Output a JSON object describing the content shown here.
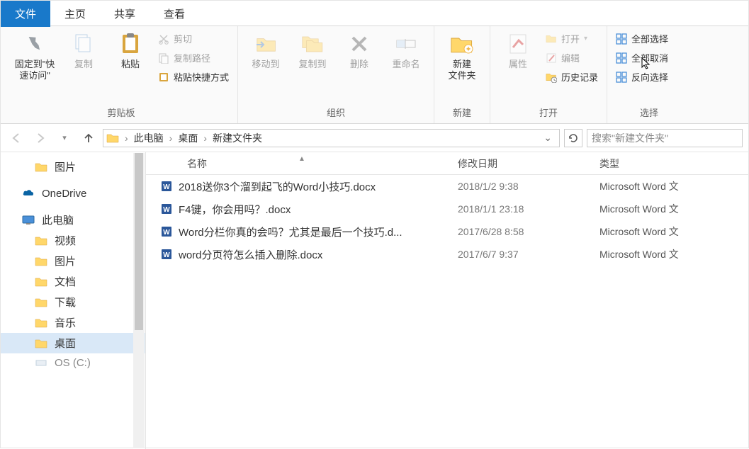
{
  "tabs": {
    "file": "文件",
    "home": "主页",
    "share": "共享",
    "view": "查看"
  },
  "ribbon": {
    "clipboard": {
      "pin": "固定到\"快\n速访问\"",
      "copy": "复制",
      "paste": "粘贴",
      "cut": "剪切",
      "copy_path": "复制路径",
      "paste_shortcut": "粘贴快捷方式",
      "label": "剪贴板"
    },
    "organize": {
      "move_to": "移动到",
      "copy_to": "复制到",
      "delete": "删除",
      "rename": "重命名",
      "label": "组织"
    },
    "new": {
      "new_folder": "新建\n文件夹",
      "label": "新建"
    },
    "open": {
      "properties": "属性",
      "open": "打开",
      "edit": "编辑",
      "history": "历史记录",
      "label": "打开"
    },
    "select": {
      "select_all": "全部选择",
      "select_none": "全部取消",
      "invert": "反向选择",
      "label": "选择"
    }
  },
  "breadcrumb": {
    "pc": "此电脑",
    "desktop": "桌面",
    "folder": "新建文件夹"
  },
  "search": {
    "placeholder": "搜索\"新建文件夹\""
  },
  "sidebar": {
    "pictures": "图片",
    "onedrive": "OneDrive",
    "this_pc": "此电脑",
    "videos": "视频",
    "pictures2": "图片",
    "documents": "文档",
    "downloads": "下载",
    "music": "音乐",
    "desktop": "桌面",
    "os_c": "OS (C:)"
  },
  "columns": {
    "name": "名称",
    "date": "修改日期",
    "type": "类型"
  },
  "files": [
    {
      "name": "2018送你3个溜到起飞的Word小技巧.docx",
      "date": "2018/1/2 9:38",
      "type": "Microsoft Word 文"
    },
    {
      "name": "F4键，你会用吗？.docx",
      "date": "2018/1/1 23:18",
      "type": "Microsoft Word 文"
    },
    {
      "name": "Word分栏你真的会吗？尤其是最后一个技巧.d...",
      "date": "2017/6/28 8:58",
      "type": "Microsoft Word 文"
    },
    {
      "name": "word分页符怎么插入删除.docx",
      "date": "2017/6/7 9:37",
      "type": "Microsoft Word 文"
    }
  ]
}
